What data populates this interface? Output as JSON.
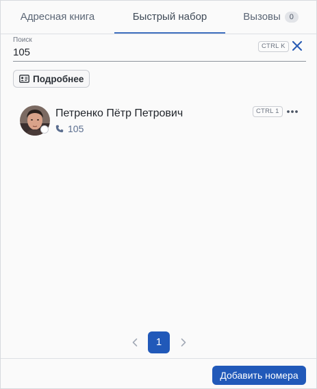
{
  "tabs": [
    {
      "label": "Адресная книга",
      "active": false
    },
    {
      "label": "Быстрый набор",
      "active": true
    },
    {
      "label": "Вызовы",
      "active": false,
      "badge": "0"
    }
  ],
  "search": {
    "label": "Поиск",
    "value": "105",
    "shortcut": "CTRL K"
  },
  "details_button": {
    "label": "Подробнее",
    "icon": "contact-card-icon"
  },
  "contacts": [
    {
      "name": "Петренко Пётр Петрович",
      "phone": "105",
      "shortcut": "CTRL 1",
      "status": "offline"
    }
  ],
  "pagination": {
    "current_page": "1"
  },
  "footer": {
    "add_button_label": "Добавить номера"
  },
  "colors": {
    "accent": "#2159b9",
    "tab_underline": "#3f6fbf",
    "phone_text": "#5b6e8f"
  }
}
